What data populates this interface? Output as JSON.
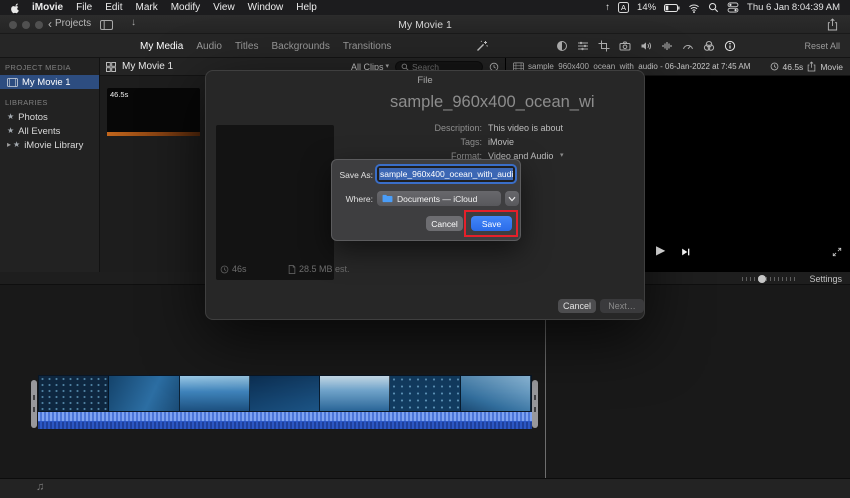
{
  "icons": {
    "star": "★",
    "chevron_down": "▾",
    "back_chevron": "‹",
    "up_arrow": "↑",
    "down_arrow": "↓",
    "play": "▶",
    "music_notes": "♫",
    "disclosure_right": "▸",
    "input_source": "A"
  },
  "menu_bar": {
    "app_menus": [
      "iMovie",
      "File",
      "Edit",
      "Mark",
      "Modify",
      "View",
      "Window",
      "Help"
    ],
    "battery_percent": "14%",
    "clock": "Thu 6 Jan 8:04:39 AM"
  },
  "title_bar": {
    "back_label": "Projects",
    "window_title": "My Movie 1"
  },
  "toolbar": {
    "tabs": [
      "My Media",
      "Audio",
      "Titles",
      "Backgrounds",
      "Transitions"
    ],
    "reset_all_label": "Reset All"
  },
  "sidebar": {
    "project_media_header": "PROJECT MEDIA",
    "project_item": "My Movie 1",
    "libraries_header": "LIBRARIES",
    "library_items": [
      "Photos",
      "All Events",
      "iMovie Library"
    ]
  },
  "browser": {
    "title": "My Movie 1",
    "filter_label": "All Clips",
    "search_placeholder": "Search",
    "clip_duration_badge": "46.5s"
  },
  "viewer": {
    "clip_info": "sample_960x400_ocean_with_audio - 06-Jan-2022 at 7:45 AM",
    "duration": "46.5s",
    "media_type": "Movie"
  },
  "export_dialog": {
    "header": "File",
    "display_name": "sample_960x400_ocean_wi",
    "description_label": "Description:",
    "description_value": "This video is about",
    "tags_label": "Tags:",
    "tags_value": "iMovie",
    "format_label": "Format:",
    "format_value": "Video and Audio",
    "duration_info": "46s",
    "size_info": "28.5 MB est.",
    "cancel_label": "Cancel",
    "next_label": "Next…"
  },
  "save_sheet": {
    "save_as_label": "Save As:",
    "filename_value": "sample_960x400_ocean_with_audi",
    "where_label": "Where:",
    "where_value": "Documents — iCloud",
    "cancel_label": "Cancel",
    "save_label": "Save"
  },
  "timeline": {
    "settings_label": "Settings"
  }
}
